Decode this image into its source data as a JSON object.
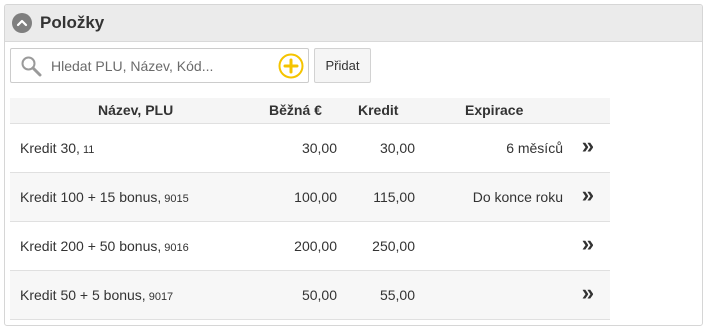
{
  "panel": {
    "title": "Položky",
    "collapse_icon": "chevron-up-icon"
  },
  "search": {
    "placeholder": "Hledat PLU, Název, Kód...",
    "value": "",
    "icon": "search-icon",
    "add_icon": "plus-circle-icon",
    "add_icon_color": "#f5c400"
  },
  "add_button": {
    "label": "Přidat"
  },
  "table": {
    "columns": {
      "name": "Název, PLU",
      "price": "Běžná €",
      "credit": "Kredit",
      "expiration": "Expirace"
    },
    "rows": [
      {
        "name": "Kredit 30,",
        "plu": "11",
        "price": "30,00",
        "credit": "30,00",
        "expiration": "6 měsíců",
        "action": "»"
      },
      {
        "name": "Kredit 100 + 15 bonus,",
        "plu": "9015",
        "price": "100,00",
        "credit": "115,00",
        "expiration": "Do konce roku",
        "action": "»"
      },
      {
        "name": "Kredit 200 + 50 bonus,",
        "plu": "9016",
        "price": "200,00",
        "credit": "250,00",
        "expiration": "",
        "action": "»"
      },
      {
        "name": "Kredit 50 + 5 bonus,",
        "plu": "9017",
        "price": "50,00",
        "credit": "55,00",
        "expiration": "",
        "action": "»"
      }
    ]
  }
}
